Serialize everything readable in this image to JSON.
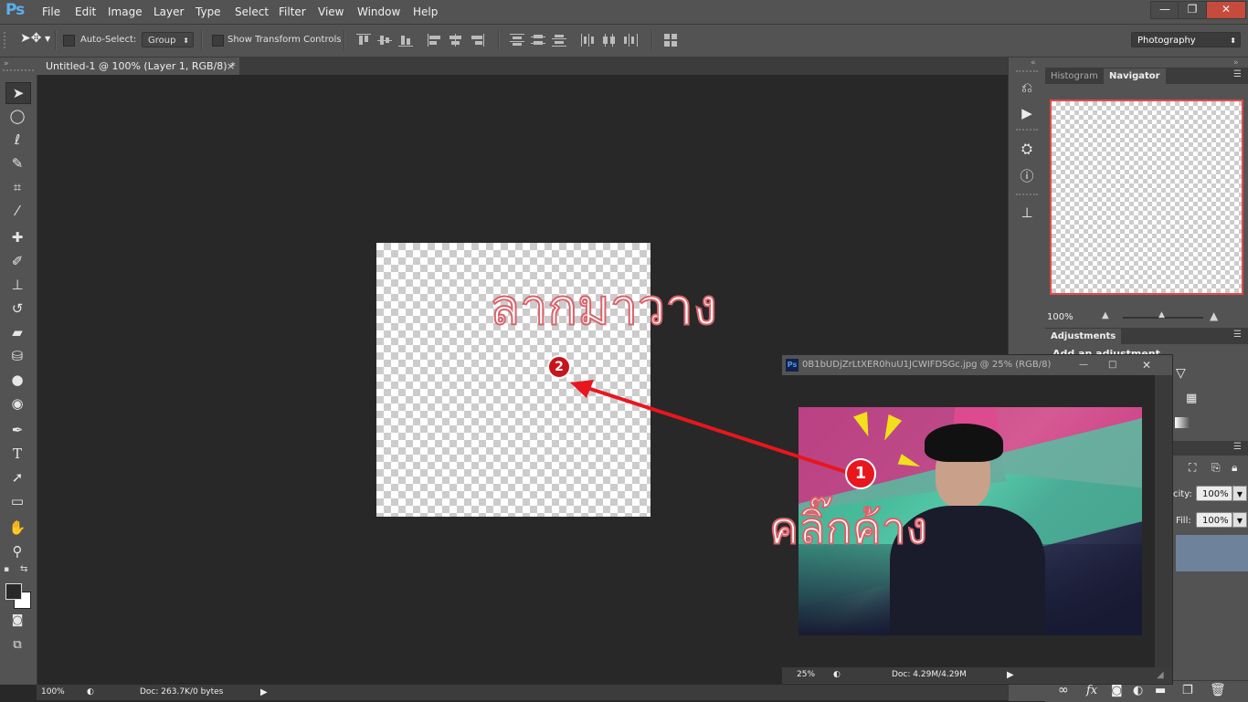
{
  "app": {
    "logo": "Ps"
  },
  "menu": [
    "File",
    "Edit",
    "Image",
    "Layer",
    "Type",
    "Select",
    "Filter",
    "View",
    "Window",
    "Help"
  ],
  "window_controls": {
    "minimize": "—",
    "restore": "❐",
    "close": "✕"
  },
  "options_bar": {
    "auto_select_label": "Auto-Select:",
    "auto_select_value": "Group",
    "transform_label": "Show Transform Controls",
    "workspace": "Photography"
  },
  "document": {
    "tab_title": "Untitled-1 @ 100% (Layer 1, RGB/8) *",
    "tab_close": "×",
    "zoom": "100%",
    "doc_info": "Doc: 263.7K/0 bytes"
  },
  "annotations": {
    "drag_text": "ลากมาวาง",
    "click_text": "คลิ๊กค้าง",
    "step1": "1",
    "step2": "2"
  },
  "panels": {
    "histogram_tab": "Histogram",
    "navigator_tab": "Navigator",
    "nav_zoom": "100%",
    "adjustments_tab": "Adjustments",
    "add_adjustment": "Add an adjustment",
    "opacity_label": "city:",
    "opacity_value": "100%",
    "fill_label": "Fill:",
    "fill_value": "100%"
  },
  "float_window": {
    "title": "0B1bUDjZrLtXER0huU1JCWIFDSGc.jpg @ 25% (RGB/8)",
    "ps_badge": "Ps",
    "zoom": "25%",
    "doc_info": "Doc: 4.29M/4.29M"
  },
  "colors": {
    "chrome": "#535353",
    "canvas_bg": "#282828",
    "arrow": "#e8161d",
    "annotation_text": "#d9636b"
  }
}
